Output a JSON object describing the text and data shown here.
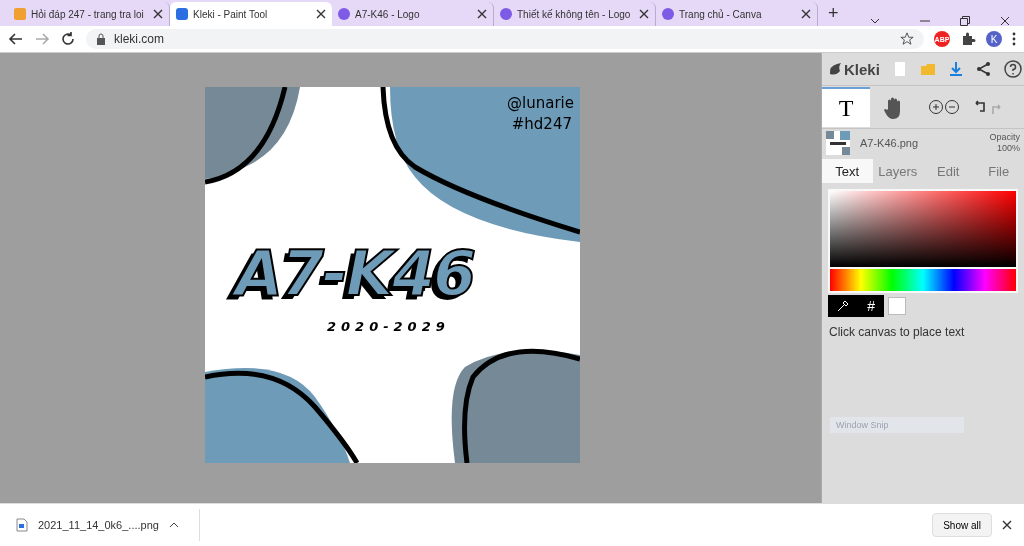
{
  "browser": {
    "tabs": [
      {
        "title": "Hỏi đáp 247 - trang tra loi",
        "selected": false,
        "kind": "hoidap"
      },
      {
        "title": "Kleki - Paint Tool",
        "selected": true,
        "kind": "kleki"
      },
      {
        "title": "A7-K46 - Logo",
        "selected": false,
        "kind": "canva"
      },
      {
        "title": "Thiết kế không tên - Logo",
        "selected": false,
        "kind": "canva"
      },
      {
        "title": "Trang chủ - Canva",
        "selected": false,
        "kind": "canva"
      }
    ],
    "new_tab": "+",
    "address": "kleki.com",
    "profile_initial": "K",
    "extension_badge": "ABP"
  },
  "canvas": {
    "artwork": {
      "credit": "@lunarie",
      "tag": "#hd247",
      "headline": "A7-K46",
      "years": "2020-2029"
    }
  },
  "panel": {
    "logo": "Kleki",
    "tools": [
      {
        "label": "T",
        "selected": true,
        "kind": "text"
      },
      {
        "selected": false,
        "kind": "hand"
      }
    ],
    "layer": {
      "name": "A7-K46.png",
      "opacity_label": "Opacity",
      "opacity": "100%"
    },
    "tabs": [
      {
        "label": "Text",
        "selected": true
      },
      {
        "label": "Layers",
        "selected": false
      },
      {
        "label": "Edit",
        "selected": false
      },
      {
        "label": "File",
        "selected": false
      }
    ],
    "hex_label": "#",
    "hint": "Click canvas to place text",
    "ghost": "Window Snip"
  },
  "downloads": {
    "file": "2021_11_14_0k6_....png",
    "show_all": "Show all"
  }
}
